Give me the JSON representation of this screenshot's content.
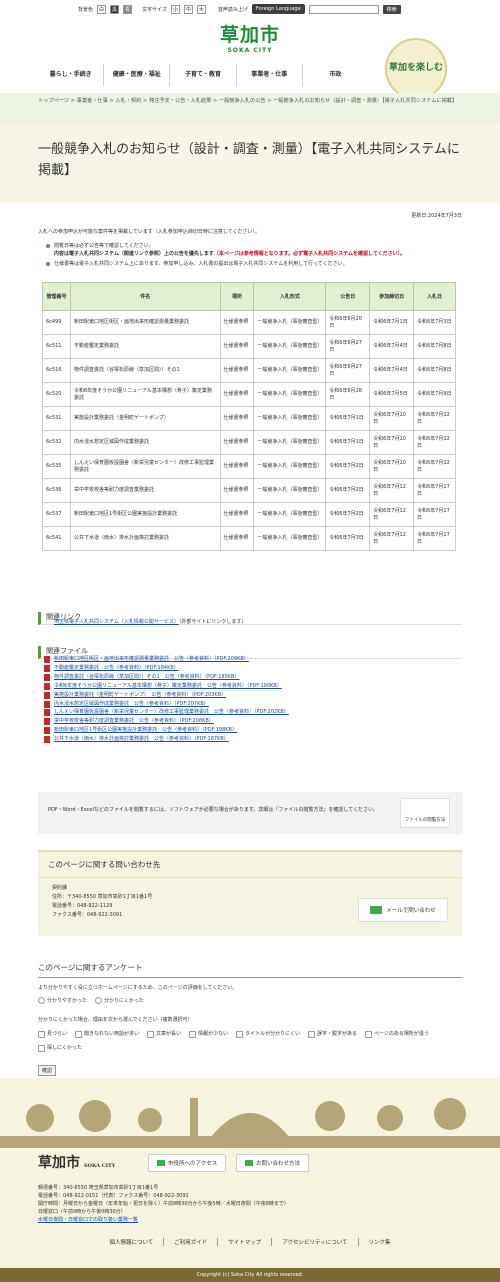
{
  "util": {
    "bg_label": "背景色",
    "bg_options": [
      "白",
      "黒",
      "青"
    ],
    "size_label": "文字サイズ",
    "size_options": [
      "小",
      "中",
      "大"
    ],
    "read_label": "音声読み上げ",
    "fl_label": "Foreign Language",
    "search_btn": "検索"
  },
  "logo": {
    "kanji": "草加市",
    "en": "SOKA CITY"
  },
  "emblem": "草加を楽しむ",
  "gnav": [
    "暮らし・手続き",
    "健康・医療・福祉",
    "子育て・教育",
    "事業者・仕事",
    "市政"
  ],
  "breadcrumb": "トップページ > 事業者・仕事 > 入札・契約 > 発注予定・公告・入札結果 > 一般競争入札の公告 > 一般競争入札のお知らせ（設計・調査・測量）【電子入札共同システムに掲載】",
  "title": "一般競争入札のお知らせ（設計・調査・測量）【電子入札共同システムに掲載】",
  "updated": "更新日:2024年7月3日",
  "intro": "入札への参加申込が可能な案件等を掲載しています（入札参加申込締切日時に注意してください）。",
  "notes": [
    {
      "a": "閲覧日等は必ず公告等で確認してください。",
      "b": "内容は電子入札共同システム（関連リンク参照）上の公告を優先します",
      "c": "（本ページは参考情報となります。必ず電子入札共同システムを確認してください）。"
    },
    {
      "a": "仕様書等は電子入札共同システム上にあります。参加申し込み、入札書の提出は電子入札共同システムを利用して行ってください。",
      "b": "",
      "c": ""
    }
  ],
  "table": {
    "headers": [
      "管理番号",
      "件名",
      "場所",
      "入札形式",
      "公告日",
      "参加締切日",
      "入札日"
    ],
    "rows": [
      [
        "6c499",
        "新田駅東口地区街区・画地出来形確認測量業務委託",
        "仕様書参照",
        "一般競争入札（事後審査型）",
        "令和6年6月20日",
        "令和6年7月1日",
        "令和6年7月3日"
      ],
      [
        "6c511",
        "不動産鑑定業務委託",
        "仕様書参照",
        "一般競争入札（事後審査型）",
        "令和6年6月27日",
        "令和6年7月4日",
        "令和6年7月8日"
      ],
      [
        "6c516",
        "物件調査委託（谷塚松原線（草加区間））その1",
        "仕様書参照",
        "一般競争入札（事後審査型）",
        "令和6年6月27日",
        "令和6年7月4日",
        "令和6年7月8日"
      ],
      [
        "6c520",
        "令和6年度そうか公園リニューアル基本構想（骨子）策定業務委託",
        "仕様書参照",
        "一般競争入札（事後審査型）",
        "令和6年6月28日",
        "令和6年7月5日",
        "令和6年7月9日"
      ],
      [
        "6c531",
        "実施設計業務委託（金明町ゲートポンプ）",
        "仕様書参照",
        "一般競争入札（事後審査型）",
        "令和6年7月1日",
        "令和6年7月10日",
        "令和6年7月12日"
      ],
      [
        "6c532",
        "内水浸水想定区域図作成業務委託",
        "仕様書参照",
        "一般競争入札（事後審査型）",
        "令和6年7月1日",
        "令和6年7月10日",
        "令和6年7月12日"
      ],
      [
        "6c535",
        "しんえい保育園仮設園舎（新栄児童センター）改修工事監理業務委託",
        "仕様書参照",
        "一般競争入札（事後審査型）",
        "令和6年7月2日",
        "令和6年7月10日",
        "令和6年7月12日"
      ],
      [
        "6c536",
        "栄中学校校舎等耐力度調査業務委託",
        "仕様書参照",
        "一般競争入札（事後審査型）",
        "令和6年7月2日",
        "令和6年7月12日",
        "令和6年7月17日"
      ],
      [
        "6c537",
        "新田駅東口地区1号街区公園実施設計業務委託",
        "仕様書参照",
        "一般競争入札（事後審査型）",
        "令和6年7月2日",
        "令和6年7月12日",
        "令和6年7月17日"
      ],
      [
        "6c541",
        "公共下水道（雨水）排水計画検討業務委託",
        "仕様書参照",
        "一般競争入札（事後審査型）",
        "令和6年7月3日",
        "令和6年7月12日",
        "令和6年7月17日"
      ]
    ]
  },
  "related": {
    "heading": "関連リンク",
    "link": "埼玉県電子入札共同システム（入札情報公開サービス）",
    "note": "（外部サイトにリンクします）"
  },
  "files": {
    "heading": "関連ファイル",
    "items": [
      "新田駅東口地区街区・画地出来形確認測量業務委託　公告（参考資料）（PDF:209KB）",
      "不動産鑑定業務委託　公告（参考資料）（PDF:184KB）",
      "物件調査委託（谷塚松原線（草加区間））その1　公告（参考資料）（PDF:185KB）",
      "令和6年度そうか公園リニューアル基本構想（骨子）策定業務委託　公告（参考資料）（PDF:190KB）",
      "実施設計業務委託（金明町ゲートポンプ）　公告（参考資料）（PDF:203KB）",
      "内水浸水想定区域図作成業務委託　公告（参考資料）（PDF:207KB）",
      "しんえい保育園仮設園舎（新栄児童センター）改修工事監理業務委託　公告（参考資料）（PDF:202KB）",
      "栄中学校校舎等耐力度調査業務委託　公告（参考資料）（PDF:208KB）",
      "新田駅東口地区1号街区公園実施設計業務委託　公告（参考資料）（PDF:198KB）",
      "公共下水道（雨水）排水計画検討業務委託　公告（参考資料）（PDF:187KB）"
    ]
  },
  "pdfnote": "PDF・Word・Excelなどのファイルを閲覧するには、ソフトウェアが必要な場合があります。詳細は「ファイルの閲覧方法」を確認してください。",
  "pdfbtn": "ファイルの閲覧方法",
  "contact": {
    "heading": "このページに関する問い合わせ先",
    "dept": "契約課",
    "addr": "住所：〒340-8550 草加市高砂1丁目1番1号",
    "tel": "電話番号：048-922-1129",
    "fax": "ファクス番号：048-922-3091",
    "mail_btn": "メールで問い合わせ"
  },
  "survey": {
    "heading": "このページに関するアンケート",
    "q1": "より分かりやすく役に立つホームページにするため、このページの評価をしてください。",
    "a1": [
      "分かりやすかった",
      "分かりにくかった"
    ],
    "q2": "分かりにくかった場合、理由を次から選んでください（複数選択可）",
    "a2": [
      "見づらい",
      "聞きなれない用語が多い",
      "文章が長い",
      "情報が少ない",
      "タイトルが分かりにくい",
      "誤字・脱字がある",
      "ページのある場所が違う",
      "探しにくかった"
    ],
    "submit": "確認"
  },
  "footer": {
    "logo": "草加市",
    "logo_en": "SOKA CITY",
    "btn1": "市役所へのアクセス",
    "btn2": "お問い合わせ方法",
    "lines": [
      "郵便番号：340-8550 埼玉県草加市高砂1丁目1番1号",
      "電話番号：048-922-0151（代表）ファクス番号：048-922-3091",
      "開庁時間：月曜日から金曜日（年末年始・祝日を除く）午前8時30分から午後5時／水曜日夜間（午後8時まで）",
      "日曜窓口（午前9時から午後0時30分）"
    ],
    "link": "水曜日夜間・日曜窓口での取り扱い業務一覧",
    "nav": [
      "個人情報について",
      "ご利用ガイド",
      "サイトマップ",
      "アクセシビリティについて",
      "リンク集"
    ],
    "copyright": "Copyright (c) Soka City All rights reserved."
  }
}
